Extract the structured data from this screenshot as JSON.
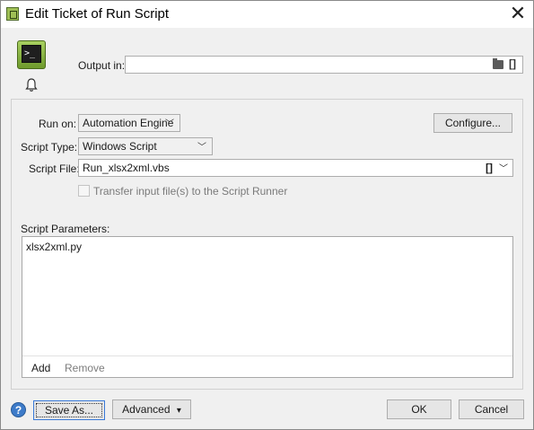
{
  "window": {
    "title": "Edit Ticket of Run Script",
    "close_glyph": "✕"
  },
  "top": {
    "script_icon_glyph": ">_",
    "output_label": "Output in:",
    "output_value": "",
    "bracket_glyph": "[]"
  },
  "panel": {
    "run_on_label": "Run on:",
    "run_on_value": "Automation Engine",
    "configure_label": "Configure...",
    "script_type_label": "Script Type:",
    "script_type_value": "Windows Script",
    "script_file_label": "Script File:",
    "script_file_value": "Run_xlsx2xml.vbs",
    "script_file_bracket": "[]",
    "transfer_label": "Transfer input file(s) to the Script Runner",
    "transfer_checked": false,
    "params_label": "Script Parameters:",
    "params": [
      "xlsx2xml.py"
    ],
    "add_label": "Add",
    "remove_label": "Remove"
  },
  "bottom": {
    "help_glyph": "?",
    "save_as_label": "Save As...",
    "advanced_label": "Advanced",
    "advanced_arrow": "▾",
    "ok_label": "OK",
    "cancel_label": "Cancel"
  },
  "icons": {
    "app": "app-icon",
    "close": "close-icon",
    "script": "terminal-icon",
    "bell": "bell-icon",
    "folder": "folder-icon",
    "help": "help-icon",
    "chevron": "chevron-down-icon"
  }
}
